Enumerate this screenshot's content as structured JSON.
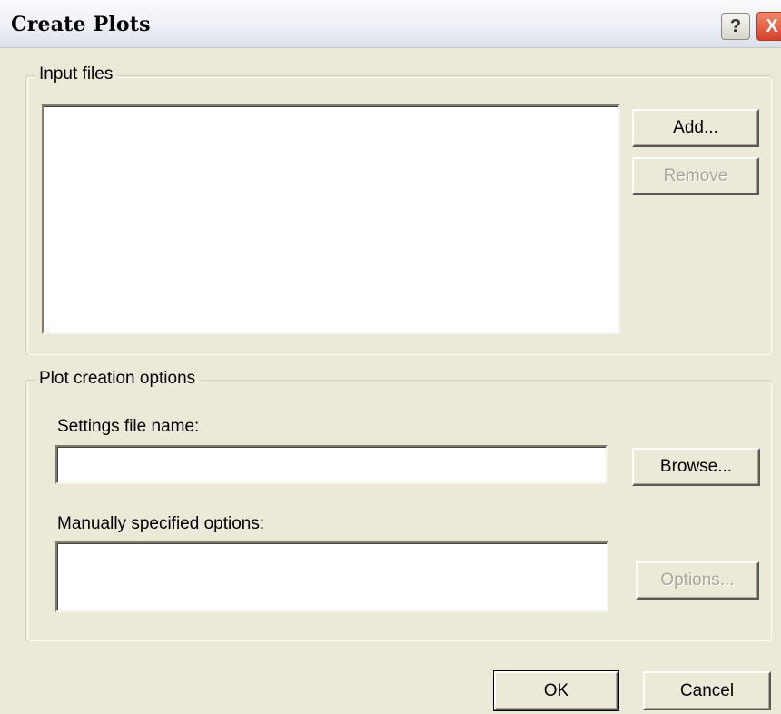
{
  "window": {
    "title": "Create Plots",
    "help_label": "?",
    "close_label": "X"
  },
  "input_files": {
    "legend": "Input files",
    "add_label": "Add...",
    "remove_label": "Remove"
  },
  "plot_options": {
    "legend": "Plot creation options",
    "settings_label": "Settings file name:",
    "settings_value": "",
    "browse_label": "Browse...",
    "manual_label": "Manually specified options:",
    "manual_value": "",
    "options_label": "Options..."
  },
  "footer": {
    "ok_label": "OK",
    "cancel_label": "Cancel"
  }
}
